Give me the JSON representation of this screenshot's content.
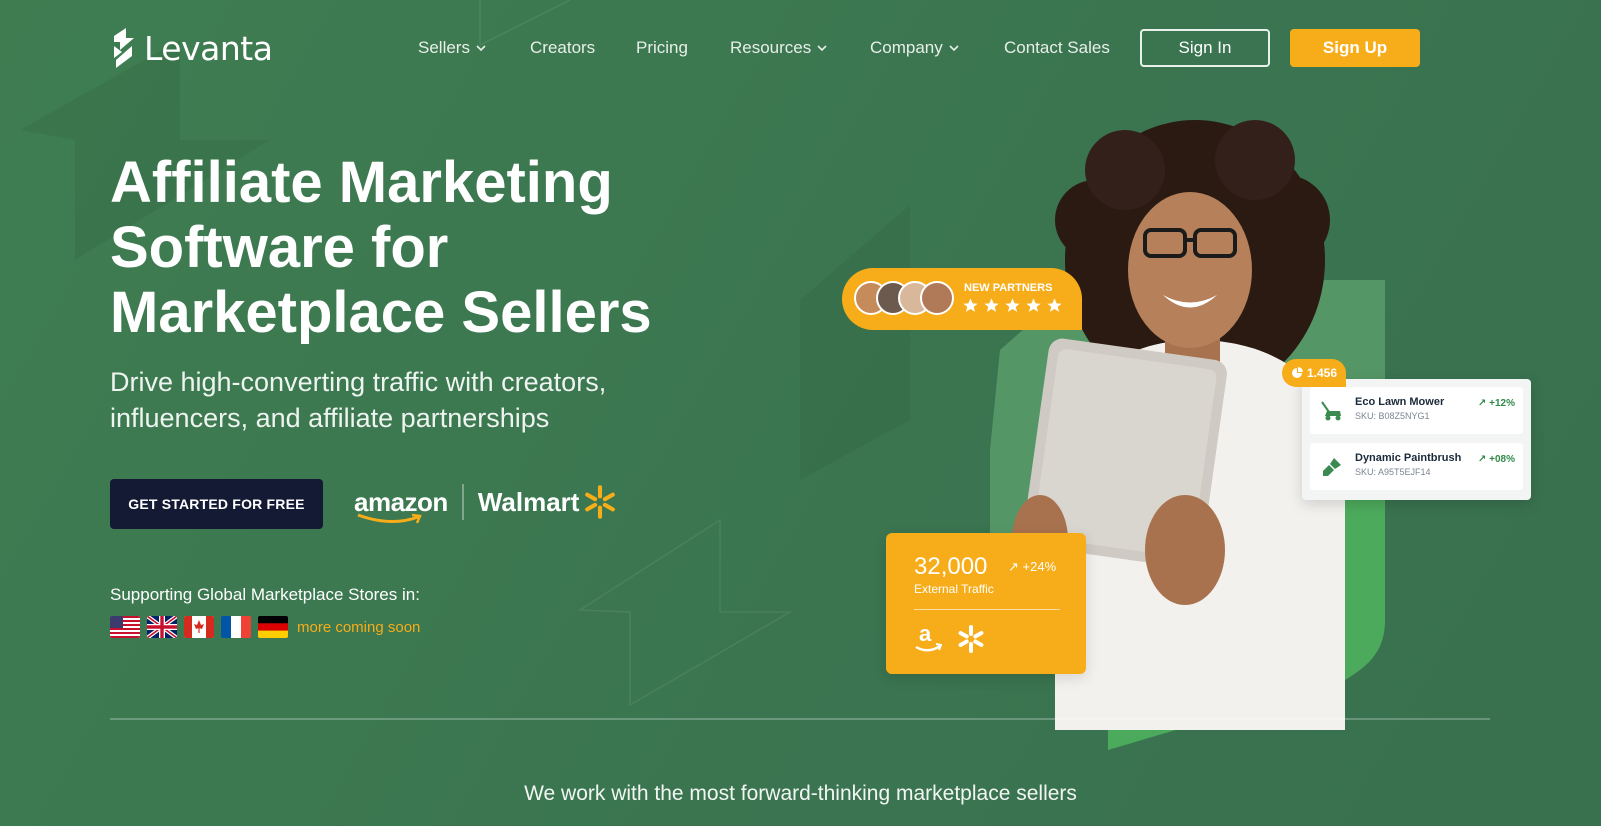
{
  "brand": {
    "name": "Levanta"
  },
  "nav": {
    "items": [
      {
        "label": "Sellers",
        "has_dropdown": true
      },
      {
        "label": "Creators",
        "has_dropdown": false
      },
      {
        "label": "Pricing",
        "has_dropdown": false
      },
      {
        "label": "Resources",
        "has_dropdown": true
      },
      {
        "label": "Company",
        "has_dropdown": true
      },
      {
        "label": "Contact Sales",
        "has_dropdown": false
      }
    ],
    "sign_in": "Sign In",
    "sign_up": "Sign Up"
  },
  "hero": {
    "title": "Affiliate Marketing Software for Marketplace Sellers",
    "subtitle": "Drive high-converting traffic with creators, influencers, and affiliate partnerships",
    "cta": "GET STARTED FOR FREE",
    "marketplaces": [
      "amazon",
      "Walmart"
    ],
    "support_label": "Supporting Global Marketplace Stores in:",
    "flags": [
      "us-flag",
      "uk-flag",
      "canada-flag",
      "france-flag",
      "germany-flag"
    ],
    "more_soon": "more coming soon"
  },
  "cards": {
    "partners_label": "NEW PARTNERS",
    "rating_stars": 5,
    "badge_value": "1.456",
    "products": [
      {
        "name": "Eco Lawn Mower",
        "sku": "SKU: B08Z5NYG1",
        "change": "+12%",
        "icon": "lawn-mower-icon"
      },
      {
        "name": "Dynamic Paintbrush",
        "sku": "SKU: A95T5EJF14",
        "change": "+08%",
        "icon": "paintbrush-icon"
      }
    ],
    "traffic_value": "32,000",
    "traffic_change": "+24%",
    "traffic_label": "External Traffic"
  },
  "footer_tagline": "We work with the most forward-thinking marketplace sellers",
  "colors": {
    "background": "#3e7a51",
    "accent": "#f7ad19",
    "cta_dark": "#141a33",
    "shape_light": "#6bb27a",
    "shape_bright": "#4caa5c"
  }
}
